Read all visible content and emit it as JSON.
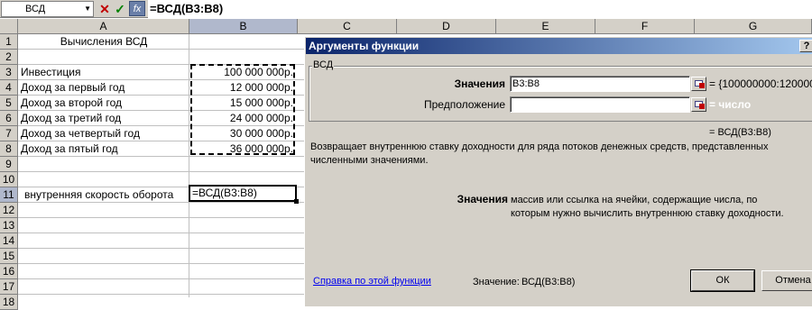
{
  "formula_bar": {
    "name_box": "ВСД",
    "cancel_glyph": "✕",
    "enter_glyph": "✓",
    "fx_label": "fx",
    "formula": "=ВСД(B3:B8)"
  },
  "columns": [
    "A",
    "B",
    "C",
    "D",
    "E",
    "F",
    "G"
  ],
  "rows": [
    "1",
    "2",
    "3",
    "4",
    "5",
    "6",
    "7",
    "8",
    "9",
    "10",
    "11",
    "12",
    "13",
    "14",
    "15",
    "16",
    "17",
    "18"
  ],
  "cells": {
    "a1": "Вычисления ВСД",
    "a3": "Инвестиция",
    "b3": "100 000 000р.",
    "a4": "Доход за первый год",
    "b4": "12 000 000р.",
    "a5": "Доход за второй год",
    "b5": "15 000 000р.",
    "a6": "Доход за третий год",
    "b6": "24 000 000р.",
    "a7": "Доход за четвертый год",
    "b7": "30 000 000р.",
    "a8": "Доход за пятый год",
    "b8": "36 000 000р.",
    "a11": "внутренняя скорость оборота",
    "b11": "=ВСД(B3:B8)"
  },
  "dialog": {
    "title": "Аргументы функции",
    "help_glyph": "?",
    "group_label": "ВСД",
    "arg1_label": "Значения",
    "arg1_value": "B3:B8",
    "arg1_result": "= {100000000:120000",
    "arg2_label": "Предположение",
    "arg2_value": "",
    "arg2_result": "= число",
    "formula_result": "= ВСД(B3:B8)",
    "description": "Возвращает внутреннюю ставку доходности для ряда потоков денежных средств, представленных численными значениями.",
    "param_name": "Значения",
    "param_desc": "массив или ссылка на ячейки, содержащие числа, по которым нужно вычислить внутреннюю ставку доходности.",
    "help_link": "Справка по этой функции",
    "value_label": "Значение:",
    "value": "ВСД(B3:B8)",
    "ok_label": "ОК",
    "cancel_label": "Отмена"
  }
}
